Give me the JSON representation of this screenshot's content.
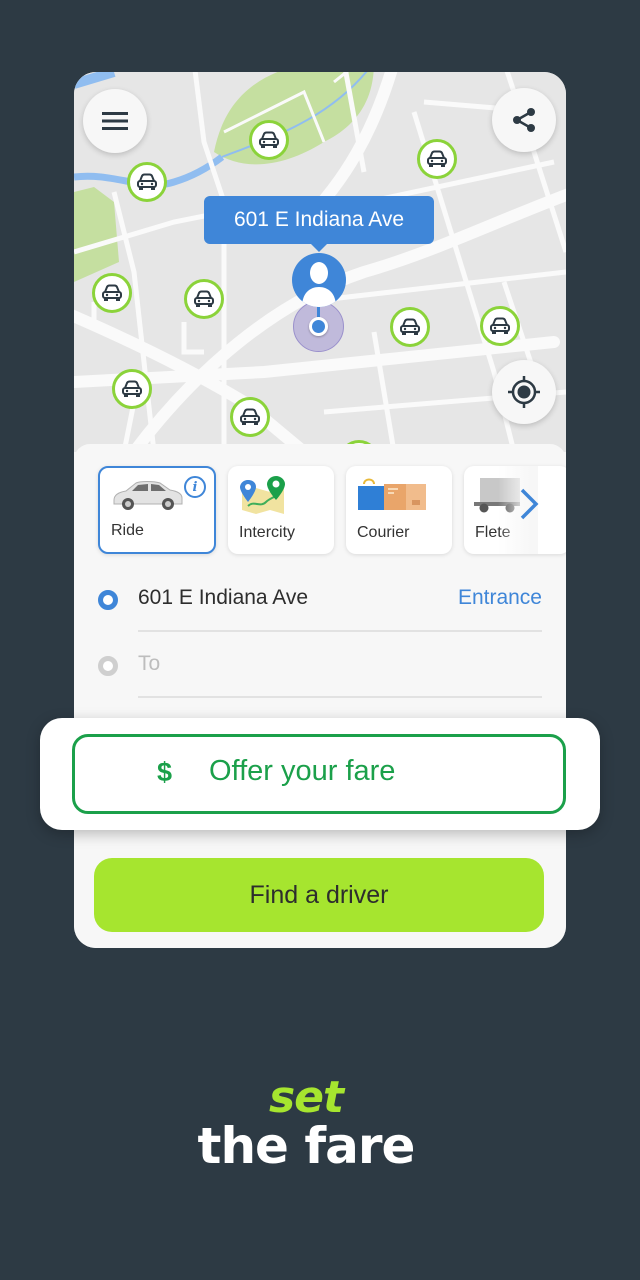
{
  "map": {
    "pickup_bubble": "601 E Indiana Ave",
    "menu_icon": "hamburger-menu-icon",
    "share_icon": "share-icon",
    "locate_icon": "my-location-icon",
    "car_icon": "car-icon",
    "nearby_cars_count": 11
  },
  "services": {
    "items": [
      {
        "label": "Ride",
        "icon": "sedan-car-icon",
        "selected": true,
        "info_badge": "i"
      },
      {
        "label": "Intercity",
        "icon": "map-route-pins-icon",
        "selected": false
      },
      {
        "label": "Courier",
        "icon": "shopping-bag-box-icon",
        "selected": false
      },
      {
        "label": "Flete",
        "icon": "truck-icon",
        "selected": false
      }
    ],
    "next_icon": "chevron-right-icon"
  },
  "route": {
    "from": {
      "value": "601 E Indiana Ave",
      "action": "Entrance"
    },
    "to": {
      "placeholder": "To"
    }
  },
  "fare": {
    "currency": "$",
    "label": "Offer your fare"
  },
  "find_button": {
    "label": "Find a driver"
  },
  "tagline": {
    "line1": "set",
    "line2": "the fare"
  },
  "colors": {
    "background": "#2d3a44",
    "brand_green": "#a6e52f",
    "fare_green": "#1ba04a",
    "accent_blue": "#3f86d8"
  }
}
